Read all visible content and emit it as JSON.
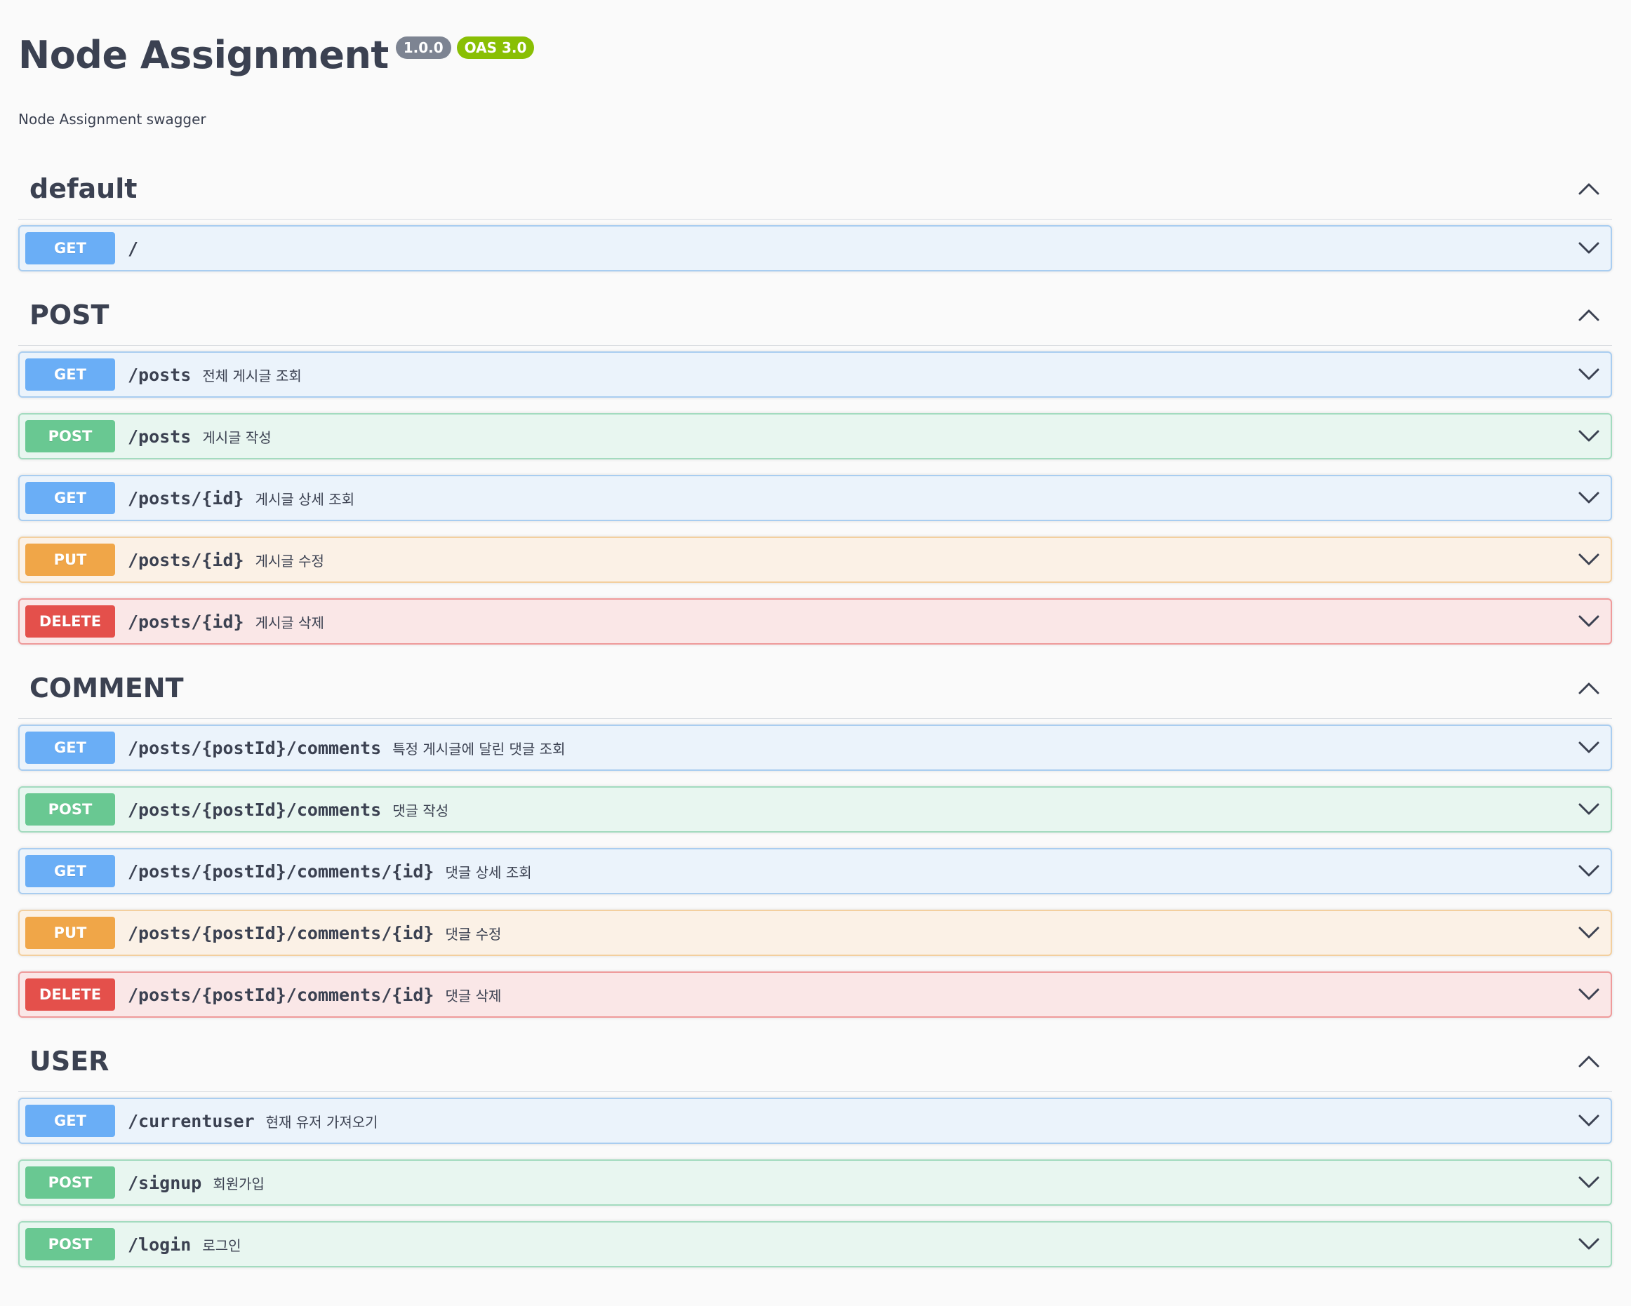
{
  "header": {
    "title": "Node Assignment",
    "version_badge": "1.0.0",
    "oas_badge": "OAS 3.0",
    "description": "Node Assignment swagger"
  },
  "sections": [
    {
      "name": "default",
      "operations": [
        {
          "method": "GET",
          "path": "/",
          "summary": ""
        }
      ]
    },
    {
      "name": "POST",
      "operations": [
        {
          "method": "GET",
          "path": "/posts",
          "summary": "전체 게시글 조회"
        },
        {
          "method": "POST",
          "path": "/posts",
          "summary": "게시글 작성"
        },
        {
          "method": "GET",
          "path": "/posts/{id}",
          "summary": "게시글 상세 조회"
        },
        {
          "method": "PUT",
          "path": "/posts/{id}",
          "summary": "게시글 수정"
        },
        {
          "method": "DELETE",
          "path": "/posts/{id}",
          "summary": "게시글 삭제"
        }
      ]
    },
    {
      "name": "COMMENT",
      "operations": [
        {
          "method": "GET",
          "path": "/posts/{postId}/comments",
          "summary": "특정 게시글에 달린 댓글 조회"
        },
        {
          "method": "POST",
          "path": "/posts/{postId}/comments",
          "summary": "댓글 작성"
        },
        {
          "method": "GET",
          "path": "/posts/{postId}/comments/{id}",
          "summary": "댓글 상세 조회"
        },
        {
          "method": "PUT",
          "path": "/posts/{postId}/comments/{id}",
          "summary": "댓글 수정"
        },
        {
          "method": "DELETE",
          "path": "/posts/{postId}/comments/{id}",
          "summary": "댓글 삭제"
        }
      ]
    },
    {
      "name": "USER",
      "operations": [
        {
          "method": "GET",
          "path": "/currentuser",
          "summary": "현재 유저 가져오기"
        },
        {
          "method": "POST",
          "path": "/signup",
          "summary": "회원가입"
        },
        {
          "method": "POST",
          "path": "/login",
          "summary": "로그인"
        }
      ]
    }
  ],
  "icons": {
    "section_toggle": "chevron-up-icon",
    "operation_toggle": "chevron-down-icon"
  },
  "colors": {
    "get": "#61affe",
    "post": "#49cc90",
    "put": "#fca130",
    "delete": "#f93e3e",
    "version_badge": "#7d8492",
    "oas_badge": "#89bf04"
  }
}
